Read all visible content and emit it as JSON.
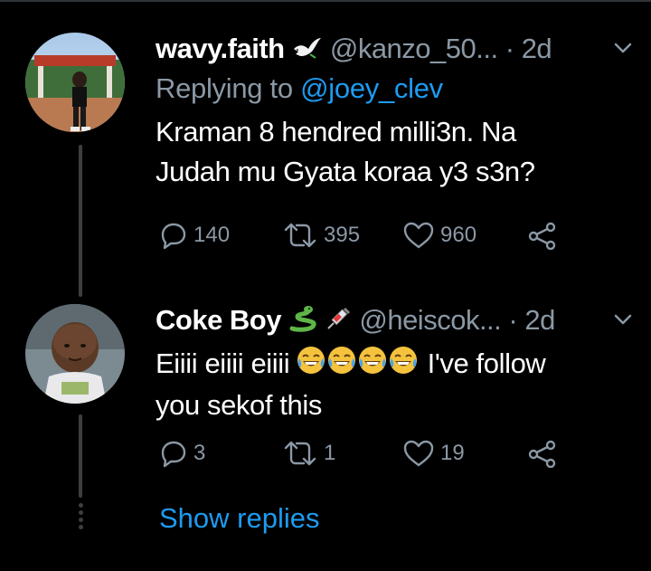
{
  "colors": {
    "background": "#000000",
    "text": "#ffffff",
    "muted": "#8b98a5",
    "accent": "#1d9bf0",
    "thread_line": "#3b3f42"
  },
  "tweets": [
    {
      "name": "wavy.faith",
      "name_emoji": "dove",
      "handle": "@kanzo_50...",
      "dot": "·",
      "time": "2d",
      "replying_prefix": "Replying to",
      "replying_mention": "@joey_clev",
      "text_line1": "Kraman 8 hendred milli3n. Na",
      "text_line2": "Judah mu Gyata koraa y3 s3n?",
      "replies": "140",
      "retweets": "395",
      "likes": "960"
    },
    {
      "name": "Coke Boy",
      "name_emoji": "snake, syringe",
      "handle": "@heiscok...",
      "dot": "·",
      "time": "2d",
      "text_line1_before": "Eiiii eiiii eiiii",
      "text_emoji": "face-with-tears-of-joy ×4",
      "text_line1_after": "I've follow",
      "text_line2": "you sekof this",
      "replies": "3",
      "retweets": "1",
      "likes": "19"
    }
  ],
  "show_replies_label": "Show replies",
  "icons": [
    "reply-icon",
    "retweet-icon",
    "like-icon",
    "share-icon",
    "chevron-down-icon"
  ]
}
